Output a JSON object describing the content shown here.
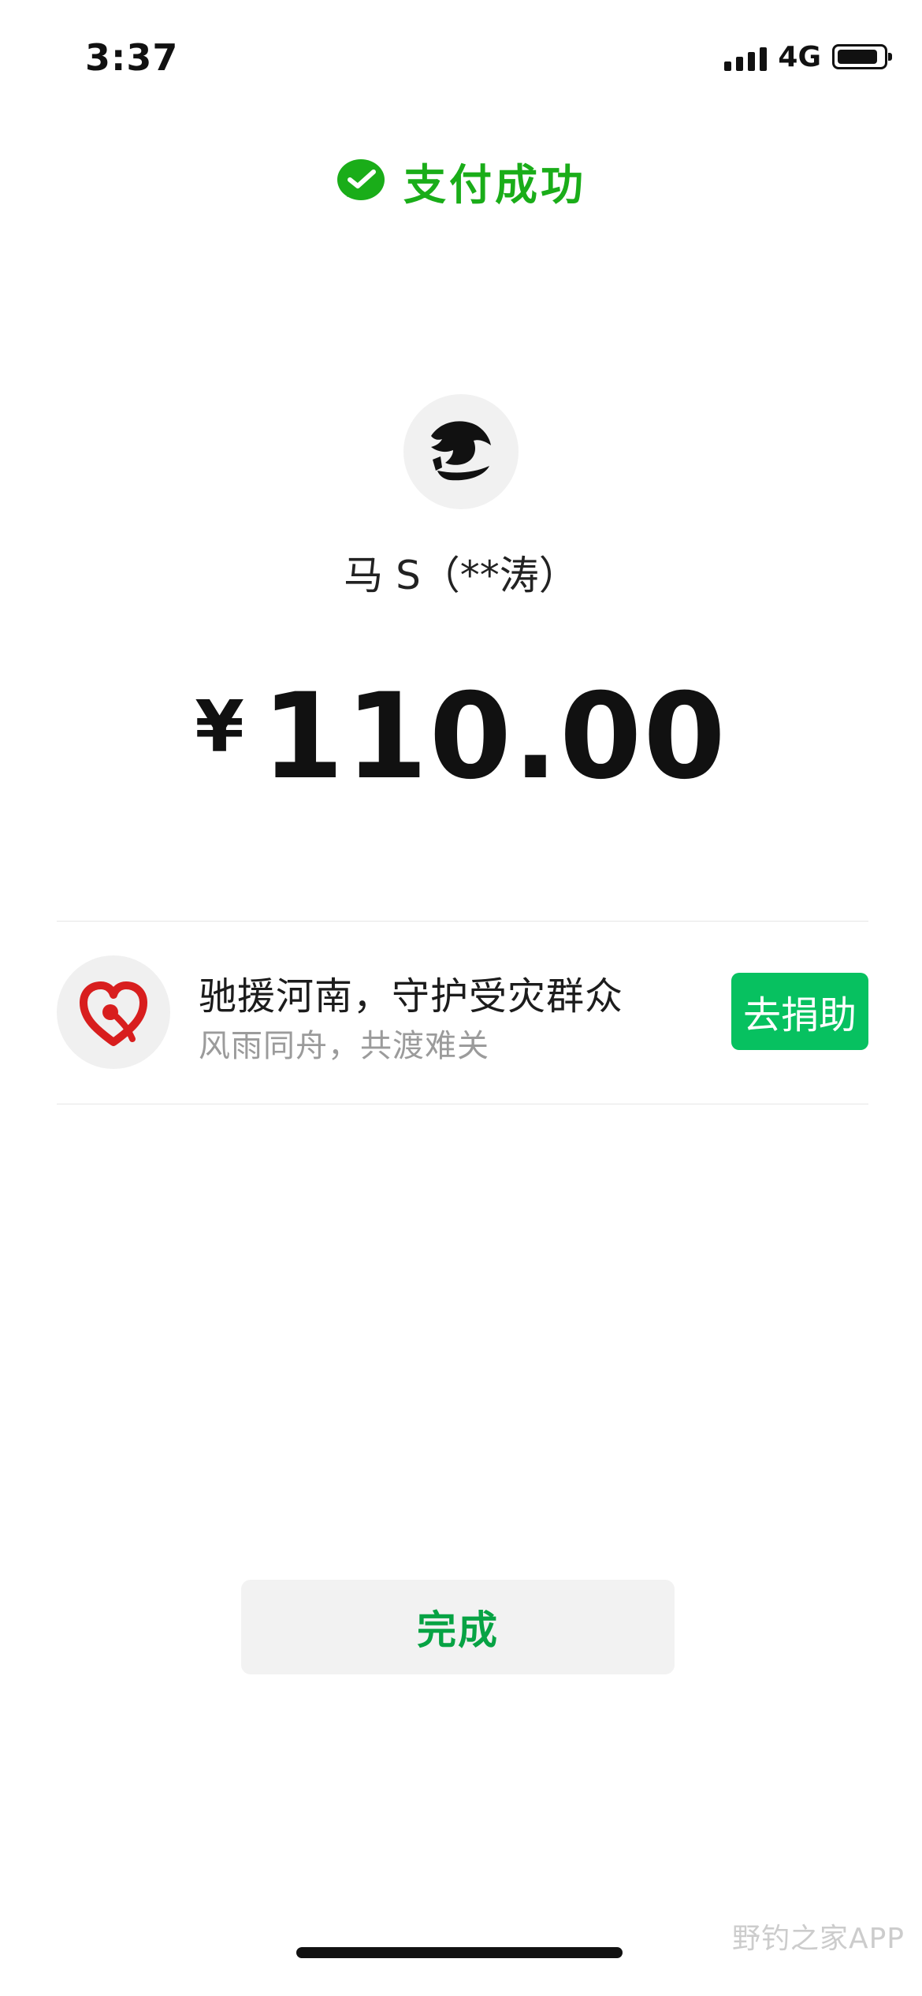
{
  "status_bar": {
    "time": "3:37",
    "network": "4G"
  },
  "header": {
    "title": "支付成功",
    "icon": "wechat-pay-icon",
    "accent_color": "#1aad19"
  },
  "payee": {
    "name": "马 S（**涛）",
    "avatar": "horse-calligraphy-avatar"
  },
  "payment": {
    "currency_symbol": "¥",
    "amount": "110.00"
  },
  "promo": {
    "logo": "charity-heart-icon",
    "title": "驰援河南，守护受灾群众",
    "subtitle": "风雨同舟，共渡难关",
    "button_label": "去捐助",
    "button_color": "#07c160"
  },
  "footer": {
    "done_label": "完成",
    "watermark": "野钓之家APP"
  }
}
